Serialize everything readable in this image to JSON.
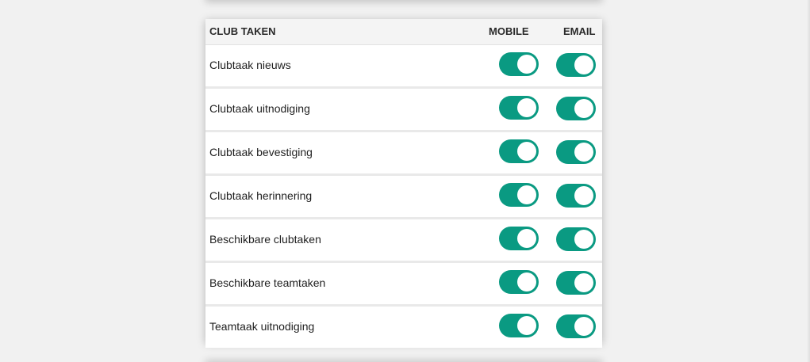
{
  "header": {
    "title": "CLUB TAKEN",
    "mobile": "MOBILE",
    "email": "EMAIL"
  },
  "rows": [
    {
      "label": "Clubtaak nieuws",
      "mobile": true,
      "email": true
    },
    {
      "label": "Clubtaak uitnodiging",
      "mobile": true,
      "email": true
    },
    {
      "label": "Clubtaak bevestiging",
      "mobile": true,
      "email": true
    },
    {
      "label": "Clubtaak herinnering",
      "mobile": true,
      "email": true
    },
    {
      "label": "Beschikbare clubtaken",
      "mobile": true,
      "email": true
    },
    {
      "label": "Beschikbare teamtaken",
      "mobile": true,
      "email": true
    },
    {
      "label": "Teamtaak uitnodiging",
      "mobile": true,
      "email": true
    }
  ],
  "colors": {
    "toggle_on": "#0a9a82",
    "toggle_off": "#bdbdbd",
    "background": "#f1f1f1"
  }
}
